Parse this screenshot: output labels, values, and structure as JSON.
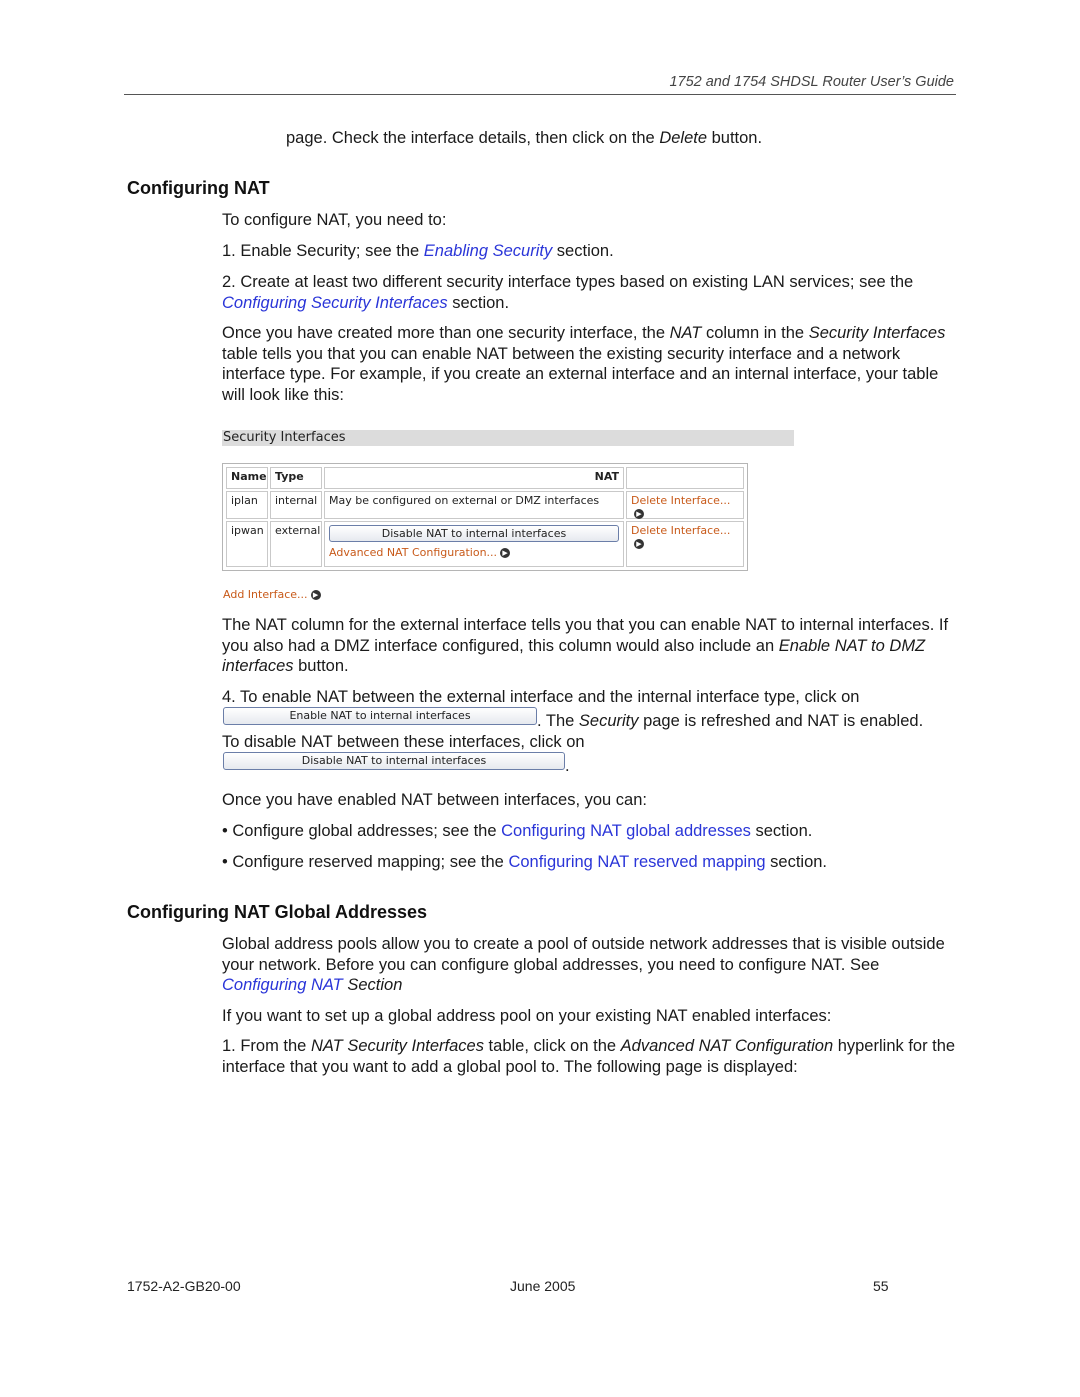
{
  "header": {
    "title": "1752 and 1754 SHDSL Router User’s Guide"
  },
  "intro": {
    "pre": "page. Check the interface details, then click on the ",
    "delete_word": "Delete",
    "post": " button."
  },
  "section1": {
    "title": "Configuring NAT",
    "p_intro": "To configure NAT, you need to:",
    "step1": {
      "pre": "1. Enable Security; see the ",
      "link": "Enabling Security",
      "post": " section."
    },
    "step2": {
      "pre": "2. Create at least two different security interface types based on existing LAN services; see the ",
      "link": "Configuring Security Interfaces",
      "post": " section."
    },
    "p_once": {
      "a": "Once you have created more than one security interface, the ",
      "nat": "NAT",
      "b": " column in the ",
      "sec": "Security Interfaces",
      "c": " table tells you that you can enable NAT between the existing security interface and a network interface type. For example, if you create an external interface and an internal interface, your table will look like this:"
    }
  },
  "screenshot": {
    "title": "Security Interfaces",
    "columns": [
      "Name",
      "Type",
      "NAT",
      ""
    ],
    "rows": [
      {
        "name": "iplan",
        "type": "internal",
        "nat": "May be configured on external or DMZ interfaces",
        "action": "Delete Interface..."
      },
      {
        "name": "ipwan",
        "type": "external",
        "nat_button": "Disable NAT to internal interfaces",
        "nat_link": "Advanced NAT Configuration...",
        "action": "Delete Interface..."
      }
    ],
    "add_link": "Add Interface..."
  },
  "section1b": {
    "p_col": {
      "a": "The NAT column for the external interface tells you that you can enable NAT to internal interfaces. If you also had a DMZ interface configured, this column would also include an ",
      "it": "Enable NAT to DMZ interfaces",
      "b": " button."
    },
    "step4": {
      "pre": "4. To enable NAT between the external interface and the internal interface type, click on",
      "enable_button": "Enable NAT to internal interfaces",
      "mid1": ". The ",
      "sec": "Security",
      "mid2": " page is refreshed and NAT is enabled.",
      "disable_text": "To disable NAT between these interfaces, click on",
      "disable_button": "Disable NAT to internal interfaces",
      "end": "."
    },
    "p_enabled": "Once you have enabled NAT between interfaces, you can:",
    "bullet1": {
      "pre": "• Configure global addresses; see the ",
      "link": "Configuring NAT global addresses",
      "post": " section."
    },
    "bullet2": {
      "pre": "• Configure reserved mapping; see the ",
      "link": "Configuring NAT reserved mapping",
      "post": " section."
    }
  },
  "section2": {
    "title": "Configuring NAT Global Addresses",
    "p1": {
      "a": "Global address pools allow you to create a pool of outside network addresses that is visible outside your network. Before you can configure global addresses, you need to configure NAT. See ",
      "link": "Configuring NAT",
      "b": " Section"
    },
    "p2": "If you want to set up a global address pool on your existing NAT enabled interfaces:",
    "step1": {
      "a": "1. From the ",
      "it1": "NAT Security Interfaces",
      "b": " table, click on the ",
      "it2": "Advanced NAT Configuration",
      "c": " hyperlink for the interface that you want to add a global pool to. The following page is displayed:"
    }
  },
  "footer": {
    "doc_id": "1752-A2-GB20-00",
    "date": "June 2005",
    "page": "55"
  }
}
